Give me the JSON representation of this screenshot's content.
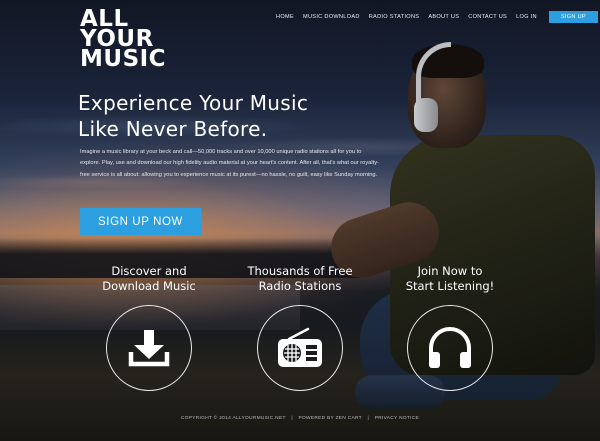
{
  "header": {
    "logo": [
      "ALL",
      "YOUR",
      "MUSIC"
    ],
    "nav": [
      "HOME",
      "MUSIC DOWNLOAD",
      "RADIO STATIONS",
      "ABOUT US",
      "CONTACT US",
      "LOG IN"
    ],
    "signup_label": "SIGN UP"
  },
  "hero": {
    "title_line1": "Experience Your Music",
    "title_line2": "Like Never Before.",
    "body": "Imagine a music library at your beck and call—50,000 tracks and over 10,000 unique radio stations all for you to explore.  Play, use and download our high fidelity audio material at your heart's content.  After all, that's what our royalty-free service is all about: allowing you to experience music at its purest—no hassle, no guilt, easy like Sunday morning.",
    "cta_label": "SIGN UP NOW"
  },
  "features": [
    {
      "line1": "Discover and",
      "line2": "Download Music",
      "icon": "download-icon"
    },
    {
      "line1": "Thousands of Free",
      "line2": "Radio Stations",
      "icon": "radio-icon"
    },
    {
      "line1": "Join Now to",
      "line2": "Start Listening!",
      "icon": "headphones-icon"
    }
  ],
  "footer": {
    "copyright": "COPYRIGHT © 2014 ALLYOURMUSIC.NET",
    "powered": "POWERED BY ZEN CART",
    "privacy": "PRIVACY NOTICE",
    "separator": "|"
  },
  "colors": {
    "accent": "#2b9fe0"
  }
}
